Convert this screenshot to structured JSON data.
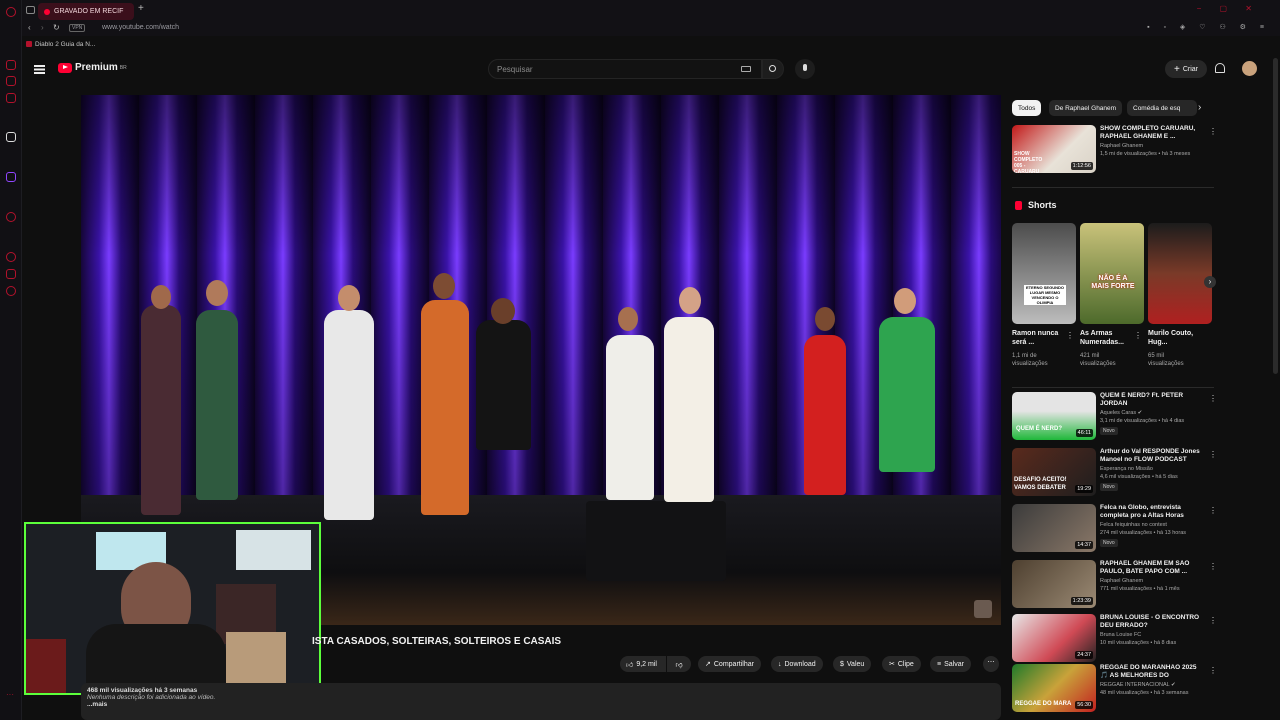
{
  "browser": {
    "tab_title": "GRAVADO EM RECIF",
    "url": "www.youtube.com/watch",
    "vpn": "VPN",
    "bookmark": "Diablo 2 Guia da N..."
  },
  "header": {
    "logo": "Premium",
    "region": "BR",
    "search_placeholder": "Pesquisar",
    "create_label": "Criar"
  },
  "video": {
    "title_visible": "ISTA CASADOS, SOLTEIRAS, SOLTEIROS E CASAIS",
    "likes": "9,2 mil",
    "share": "Compartilhar",
    "download": "Download",
    "thanks": "Valeu",
    "clip": "Clipe",
    "save": "Salvar",
    "meta": "468 mil visualizações  há 3 semanas",
    "description": "Nenhuma descrição foi adicionada ao vídeo.",
    "more": "...mais"
  },
  "chips": [
    "Todos",
    "De Raphael Ghanem",
    "Comédia de esq"
  ],
  "top_video": {
    "title": "SHOW COMPLETO CARUARU, RAPHAEL GHANEM E ...",
    "channel": "Raphael Ghanem",
    "meta": "1,5 mi de visualizações • há 3 meses",
    "duration": "1:12:56",
    "thumb_text": "SHOW COMPLETO 005 - CARUARU"
  },
  "shorts_title": "Shorts",
  "shorts": [
    {
      "title": "Ramon nunca será ...",
      "views": "1,1 mi de visualizações",
      "thumb_text": "ETERNO SEGUNDO LUGAR MESMO VENCENDO O OLIMPIA"
    },
    {
      "title": "As Armas Numeradas...",
      "views": "421 mil visualizações",
      "thumb_text": "NÃO É A MAIS FORTE"
    },
    {
      "title": "Murilo Couto, Hug...",
      "views": "65 mil visualizações",
      "thumb_text": ""
    }
  ],
  "videos": [
    {
      "title": "QUEM É NERD? Ft. PETER JORDAN",
      "channel": "Aqueles Caras ✔",
      "meta": "3,1 mi de visualizações • há 4 dias",
      "badge": "Novo",
      "duration": "46:11",
      "thumb_text": "QUEM É NERD?"
    },
    {
      "title": "Arthur do Val RESPONDE Jones Manoel no FLOW PODCAST",
      "channel": "Esperança no Missão",
      "meta": "4,6 mil visualizações • há 5 dias",
      "badge": "Novo",
      "duration": "19:29",
      "thumb_text": "DESAFIO ACEITO! VAMOS DEBATER"
    },
    {
      "title": "Felca na Globo, entrevista completa pro a Altas Horas",
      "channel": "Felca feiquinhas no context",
      "meta": "274 mil visualizações • há 13 horas",
      "badge": "Novo",
      "duration": "14:37",
      "thumb_text": ""
    },
    {
      "title": "RAPHAEL GHANEM EM SÃO PAULO, BATE PAPO COM ...",
      "channel": "Raphael Ghanem",
      "meta": "771 mil visualizações • há 1 mês",
      "badge": "",
      "duration": "1:23:39",
      "thumb_text": ""
    },
    {
      "title": "BRUNA LOUISE - O ENCONTRO DEU ERRADO?",
      "channel": "Bruna Louise FC",
      "meta": "10 mil visualizações • há 8 dias",
      "badge": "",
      "duration": "24:37",
      "thumb_text": ""
    },
    {
      "title": "REGGAE DO MARANHÃO 2025 🎵 AS MELHORES DO REGGAE...",
      "channel": "REGGAE INTERNACIONAL ✔",
      "meta": "48 mil visualizações • há 3 semanas",
      "badge": "",
      "duration": "56:30",
      "thumb_text": "REGGAE DO MARA"
    }
  ],
  "colors": {
    "accent": "#ff0033",
    "webcam_border": "#5cff3b",
    "browser_accent": "#b3122c"
  }
}
